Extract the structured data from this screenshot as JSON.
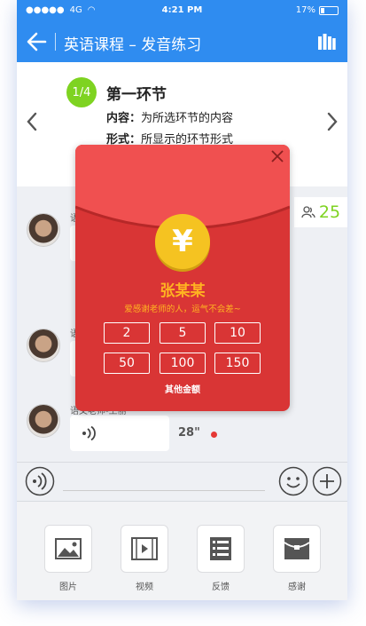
{
  "status_bar": {
    "carrier": "4G",
    "time": "4:21 PM",
    "battery": "17%"
  },
  "nav": {
    "title": "英语课程 – 发音练习"
  },
  "section": {
    "progress": "1/4",
    "title": "第一环节",
    "content_label": "内容：",
    "content_value": "为所选环节的内容",
    "form_label": "形式：",
    "form_value": "所显示的环节形式"
  },
  "chat": {
    "count": "25",
    "messages": [
      {
        "name": "语"
      },
      {
        "name": "语"
      },
      {
        "name": "语文老师-王丽",
        "duration": "28\""
      }
    ]
  },
  "attachments": [
    {
      "label": "图片",
      "icon": "image-icon"
    },
    {
      "label": "视频",
      "icon": "video-icon"
    },
    {
      "label": "反馈",
      "icon": "list-icon"
    },
    {
      "label": "感谢",
      "icon": "envelope-icon"
    }
  ],
  "red_packet": {
    "currency_symbol": "¥",
    "sender": "张某某",
    "blessing": "爱感谢老师的人，运气不会差~",
    "amounts": [
      "2",
      "5",
      "10",
      "50",
      "100",
      "150"
    ],
    "other_amount": "其他金额"
  },
  "colors": {
    "brand_blue": "#2f8cf0",
    "packet_red": "#d93535",
    "coin_gold": "#f5c321",
    "accent_green": "#7ed321",
    "text_gold": "#ffb321"
  }
}
